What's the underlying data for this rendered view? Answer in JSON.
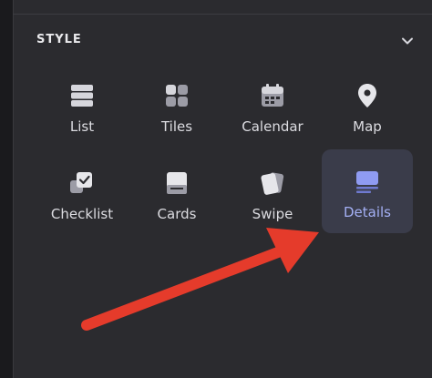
{
  "section": {
    "title": "STYLE"
  },
  "options": [
    {
      "label": "List",
      "icon": "list-icon"
    },
    {
      "label": "Tiles",
      "icon": "tiles-icon"
    },
    {
      "label": "Calendar",
      "icon": "calendar-icon"
    },
    {
      "label": "Map",
      "icon": "map-pin-icon"
    },
    {
      "label": "Checklist",
      "icon": "checklist-icon"
    },
    {
      "label": "Cards",
      "icon": "cards-icon"
    },
    {
      "label": "Swipe",
      "icon": "swipe-icon"
    },
    {
      "label": "Details",
      "icon": "details-icon",
      "selected": true
    }
  ],
  "colors": {
    "panel_bg": "#2b2b2f",
    "icon_gray": "#d6d6dc",
    "accent": "#8f9bf2",
    "selected_bg": "#3a3c4a",
    "annotation_arrow": "#e53b2b"
  }
}
